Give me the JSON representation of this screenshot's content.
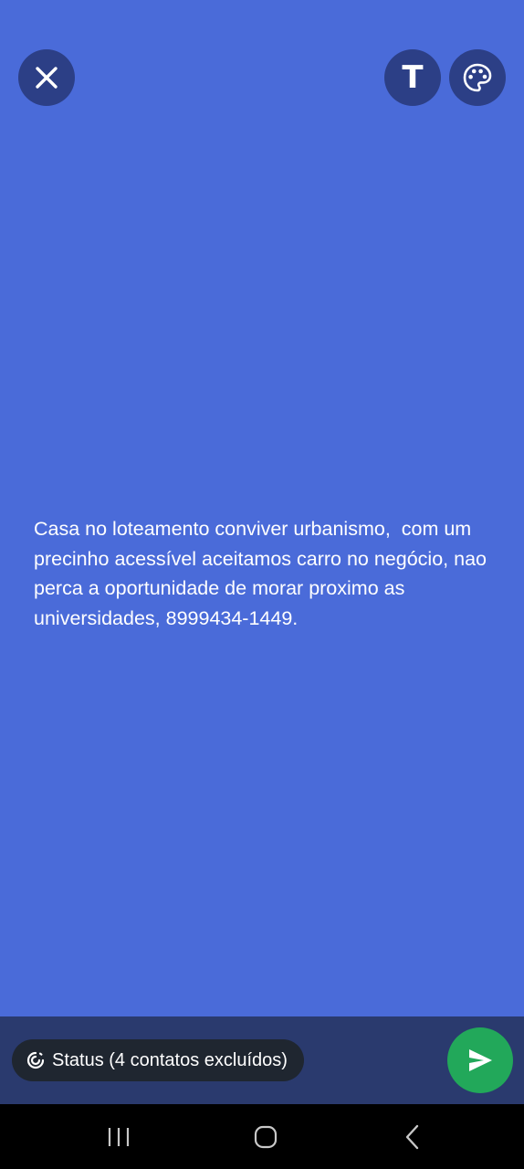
{
  "colors": {
    "background": "#4a6bd9",
    "round_button": "#2c3f86",
    "bottom_bar": "#2a3a6e",
    "pill": "#1f2630",
    "send_button": "#22a85a",
    "nav_bar": "#000000",
    "nav_icon": "#c8c8c8"
  },
  "toolbar": {
    "close_icon": "close-icon",
    "text_tool_label": "T",
    "palette_icon": "palette-icon"
  },
  "status": {
    "text": "Casa no loteamento conviver urbanismo,  com um precinho acessível aceitamos carro no negócio, nao perca a oportunidade de morar proximo as universidades, 8999434-1449."
  },
  "bottom": {
    "audience_icon": "status-ring-icon",
    "audience_label": "Status (4 contatos excluídos)",
    "send_icon": "send-icon"
  },
  "navigation": {
    "recents_icon": "recents-icon",
    "home_icon": "home-icon",
    "back_icon": "back-icon"
  }
}
